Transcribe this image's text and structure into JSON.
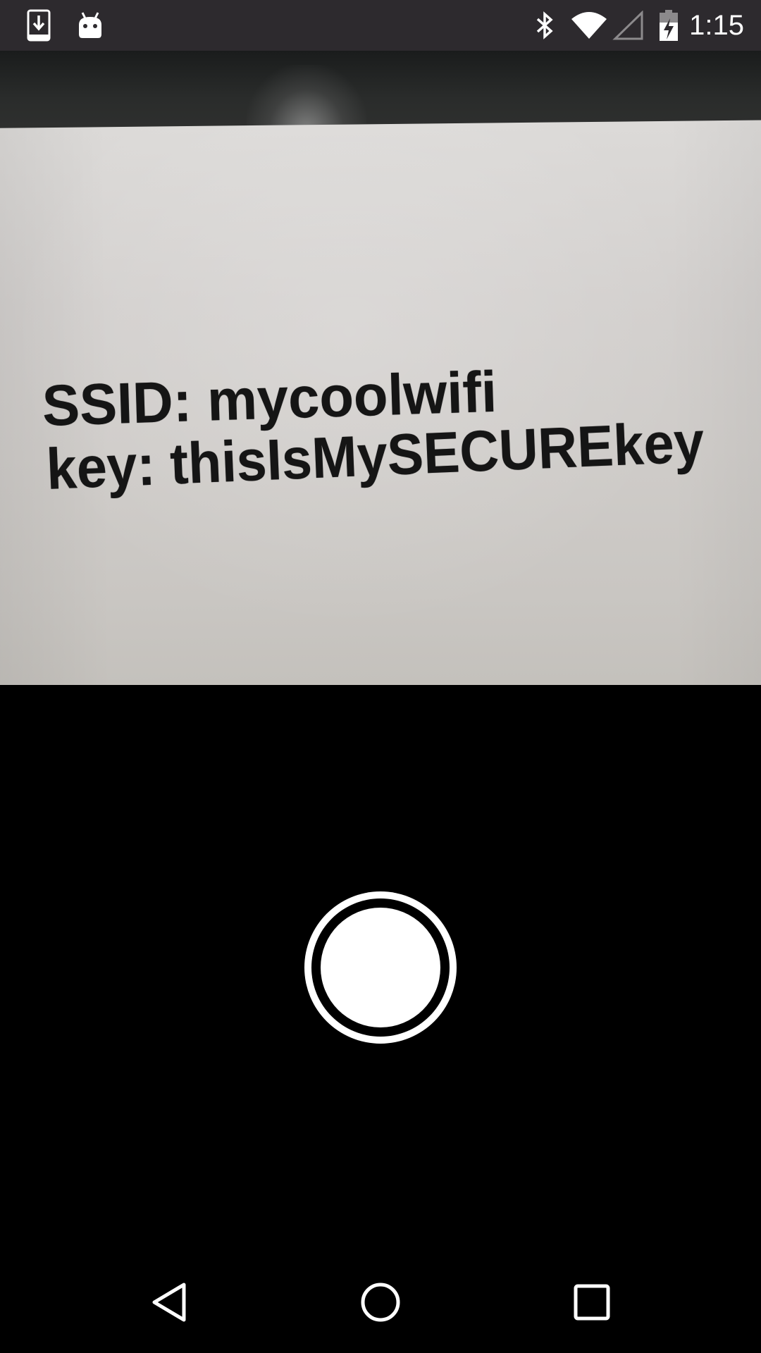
{
  "status_bar": {
    "time": "1:15",
    "left_icons": [
      "download-notification-icon",
      "android-debug-icon"
    ],
    "right_icons": [
      "bluetooth-icon",
      "wifi-icon",
      "cell-signal-icon",
      "battery-charging-icon"
    ]
  },
  "camera": {
    "photo_text_line_1": "SSID: mycoolwifi",
    "photo_text_line_2": "key: thisIsMySECUREkey"
  },
  "controls": {
    "shutter_icon": "shutter-icon"
  },
  "nav_bar": {
    "icons": [
      "back-icon",
      "home-icon",
      "recents-icon"
    ]
  },
  "colors": {
    "status_bar_bg": "#2d2a2e",
    "background": "#000000",
    "shutter": "#ffffff"
  }
}
